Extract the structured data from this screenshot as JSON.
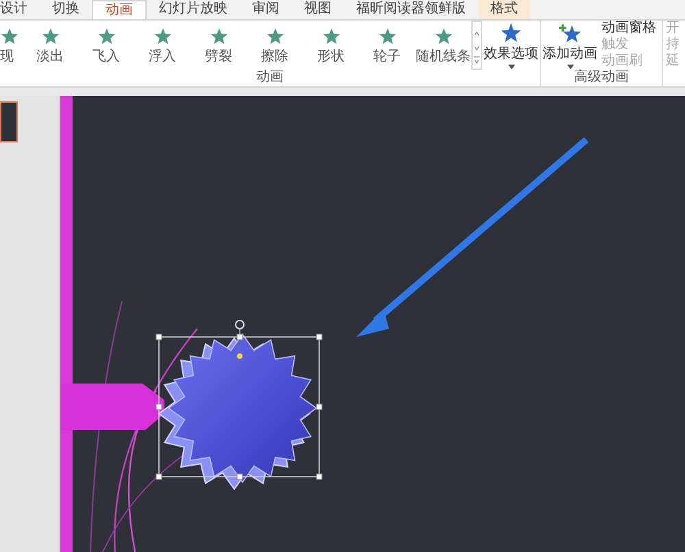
{
  "ribbon": {
    "tabs": [
      {
        "label": "设计",
        "kind": "normal",
        "selected": false
      },
      {
        "label": "切换",
        "kind": "normal",
        "selected": false
      },
      {
        "label": "动画",
        "kind": "normal",
        "selected": true
      },
      {
        "label": "幻灯片放映",
        "kind": "normal",
        "selected": false
      },
      {
        "label": "审阅",
        "kind": "normal",
        "selected": false
      },
      {
        "label": "视图",
        "kind": "normal",
        "selected": false
      },
      {
        "label": "福昕阅读器领鲜版",
        "kind": "normal",
        "selected": false
      },
      {
        "label": "格式",
        "kind": "contextual",
        "selected": false
      }
    ],
    "animation_gallery": {
      "items": [
        {
          "label": "现"
        },
        {
          "label": "淡出"
        },
        {
          "label": "飞入"
        },
        {
          "label": "浮入"
        },
        {
          "label": "劈裂"
        },
        {
          "label": "擦除"
        },
        {
          "label": "形状"
        },
        {
          "label": "轮子"
        },
        {
          "label": "随机线条"
        }
      ],
      "effect_options": "效果选项",
      "group_label": "动画"
    },
    "advanced_animation": {
      "add_animation": "添加动画",
      "commands": [
        {
          "label": "动画窗格",
          "disabled": false
        },
        {
          "label": "触发",
          "disabled": true
        },
        {
          "label": "动画刷",
          "disabled": true
        }
      ],
      "group_label": "高级动画"
    },
    "timing_items": [
      {
        "label": "开",
        "disabled": true
      },
      {
        "label": "持",
        "disabled": true
      },
      {
        "label": "延",
        "disabled": true
      }
    ]
  },
  "slides": [
    {
      "selected": true
    }
  ]
}
